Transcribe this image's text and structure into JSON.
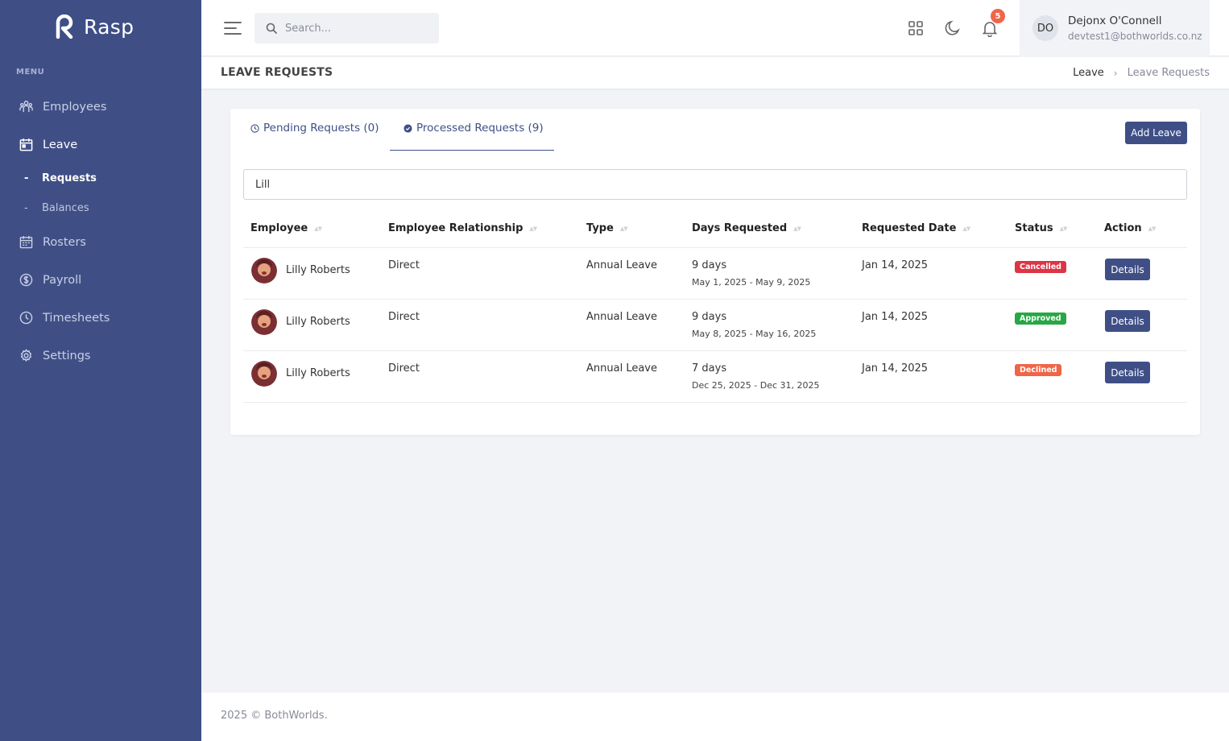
{
  "brand": {
    "name": "Rasp"
  },
  "sidebar": {
    "menu_title": "MENU",
    "items": [
      {
        "label": "Employees",
        "icon": "users-icon"
      },
      {
        "label": "Leave",
        "icon": "calendar-icon"
      },
      {
        "label": "Rosters",
        "icon": "calendar-icon"
      },
      {
        "label": "Payroll",
        "icon": "dollar-icon"
      },
      {
        "label": "Timesheets",
        "icon": "clock-icon"
      },
      {
        "label": "Settings",
        "icon": "gear-icon"
      }
    ],
    "leave_sub": [
      {
        "label": "Requests"
      },
      {
        "label": "Balances"
      }
    ]
  },
  "header": {
    "search_placeholder": "Search...",
    "notification_count": "5",
    "user": {
      "initials": "DO",
      "name": "Dejonx O'Connell",
      "email": "devtest1@bothworlds.co.nz"
    }
  },
  "page": {
    "title": "LEAVE REQUESTS",
    "breadcrumb": [
      "Leave",
      "Leave Requests"
    ]
  },
  "tabs": [
    {
      "label": "Pending Requests (0)"
    },
    {
      "label": "Processed Requests (9)"
    }
  ],
  "add_leave_label": "Add Leave",
  "filter_value": "Lill",
  "table": {
    "columns": [
      "Employee",
      "Employee Relationship",
      "Type",
      "Days Requested",
      "Requested Date",
      "Status",
      "Action"
    ],
    "rows": [
      {
        "employee": "Lilly Roberts",
        "relationship": "Direct",
        "type": "Annual Leave",
        "days": "9 days",
        "range": "May 1, 2025 - May 9, 2025",
        "requested": "Jan 14, 2025",
        "status": "Cancelled",
        "action": "Details"
      },
      {
        "employee": "Lilly Roberts",
        "relationship": "Direct",
        "type": "Annual Leave",
        "days": "9 days",
        "range": "May 8, 2025 - May 16, 2025",
        "requested": "Jan 14, 2025",
        "status": "Approved",
        "action": "Details"
      },
      {
        "employee": "Lilly Roberts",
        "relationship": "Direct",
        "type": "Annual Leave",
        "days": "7 days",
        "range": "Dec 25, 2025 - Dec 31, 2025",
        "requested": "Jan 14, 2025",
        "status": "Declined",
        "action": "Details"
      }
    ]
  },
  "colors": {
    "sidebar": "#3f4f86",
    "accent": "#3f4f86",
    "cancelled": "#dc3545",
    "approved": "#28a745",
    "declined": "#f06548"
  },
  "footer": {
    "text": "2025 © BothWorlds."
  }
}
